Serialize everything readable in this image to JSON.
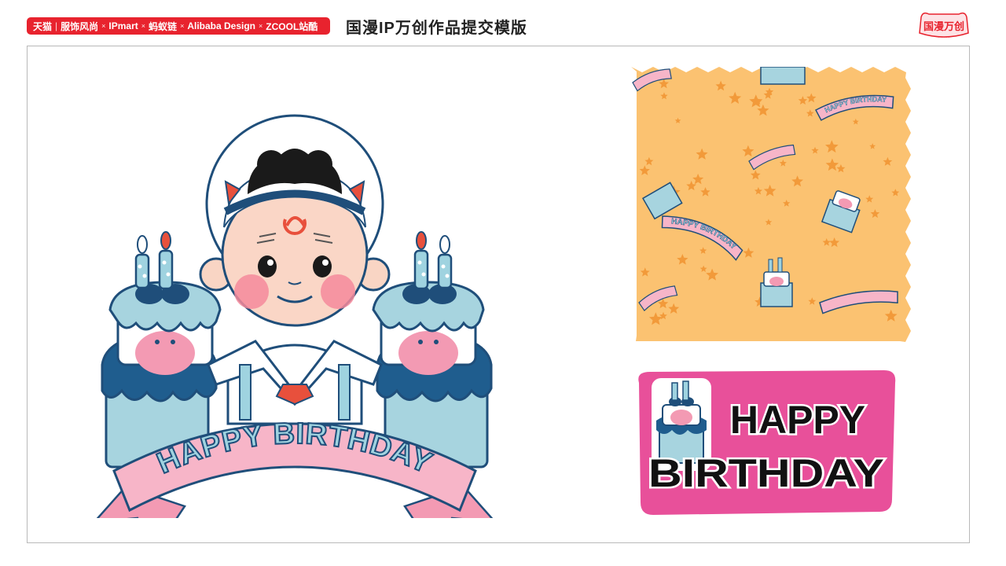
{
  "header": {
    "partners": [
      "天猫",
      "服饰风尚",
      "IPmart",
      "蚂蚁链",
      "Alibaba Design",
      "ZCOOL站酷"
    ],
    "separator": "|",
    "cross": "×",
    "title": "国漫IP万创作品提交模版",
    "logo_text": "国漫万创"
  },
  "artwork": {
    "main_banner_text": "HAPPY BIRTHDAY",
    "pattern_ribbon_text": "HAPPY BIRTHDAY",
    "sticker_line1": "HAPPY",
    "sticker_line2": "BIRTHDAY"
  },
  "colors": {
    "brand_red": "#e8232e",
    "pattern_bg": "#fbc271",
    "star": "#f29a3a",
    "sticker_pink": "#e8509a",
    "ribbon_pink": "#f7b5c8",
    "cake_blue": "#9fd3e0",
    "navy": "#1f4e7a"
  }
}
